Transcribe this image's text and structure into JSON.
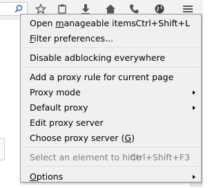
{
  "toolbar": {
    "icons": [
      "search-icon",
      "star-icon",
      "clipboard-icon",
      "download-icon",
      "home-icon",
      "phone-icon",
      "globe-icon",
      "hamburger-menu-icon"
    ]
  },
  "menu": {
    "open_manageable": {
      "pre": "Open ",
      "ul": "m",
      "post": "anageable items",
      "shortcut": "Ctrl+Shift+L"
    },
    "filter_prefs": {
      "pre": "",
      "ul": "F",
      "post": "ilter preferences..."
    },
    "disable_everywhere": {
      "label": "Disable adblocking everywhere"
    },
    "add_proxy_rule": {
      "label": "Add a proxy rule for current page"
    },
    "proxy_mode": {
      "label": "Proxy mode"
    },
    "default_proxy": {
      "label": "Default proxy"
    },
    "edit_proxy_server": {
      "label": "Edit proxy server"
    },
    "choose_proxy_server": {
      "pre": "Choose proxy server (",
      "ul": "G",
      "post": ")"
    },
    "select_element": {
      "label": "Select an element to hide",
      "shortcut": "Ctrl+Shift+F3"
    },
    "options": {
      "pre": "",
      "ul": "O",
      "post": "ptions"
    }
  }
}
